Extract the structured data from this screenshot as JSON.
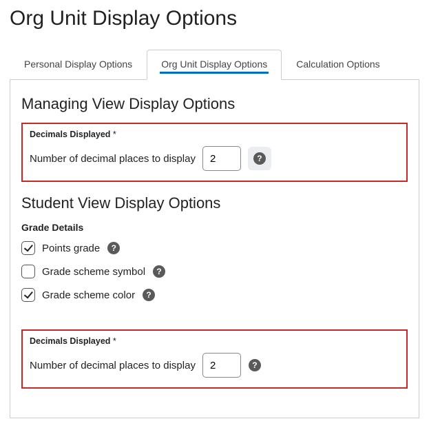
{
  "pageTitle": "Org Unit Display Options",
  "tabs": {
    "personal": "Personal Display Options",
    "orgunit": "Org Unit Display Options",
    "calc": "Calculation Options"
  },
  "managing": {
    "heading": "Managing View Display Options",
    "decimals": {
      "title": "Decimals Displayed",
      "required": "*",
      "label": "Number of decimal places to display",
      "value": "2"
    }
  },
  "student": {
    "heading": "Student View Display Options",
    "gradeDetails": {
      "heading": "Grade Details",
      "points": "Points grade",
      "symbol": "Grade scheme symbol",
      "color": "Grade scheme color"
    },
    "decimals": {
      "title": "Decimals Displayed",
      "required": "*",
      "label": "Number of decimal places to display",
      "value": "2"
    }
  }
}
